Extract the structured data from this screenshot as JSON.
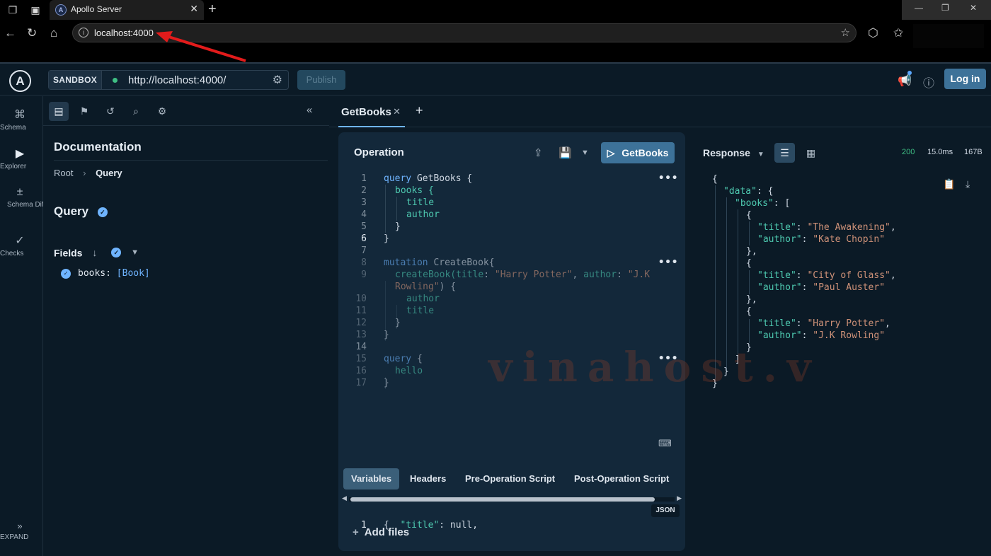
{
  "browser": {
    "tab_title": "Apollo Server",
    "address": "localhost:4000"
  },
  "header": {
    "sandbox_label": "SANDBOX",
    "endpoint": "http://localhost:4000/",
    "publish_label": "Publish",
    "login_label": "Log in"
  },
  "rail": {
    "items": [
      {
        "label": "Schema",
        "icon": "schema-icon"
      },
      {
        "label": "Explorer",
        "icon": "explorer-icon"
      },
      {
        "label": "Schema Diff",
        "icon": "schema-diff-icon"
      },
      {
        "label": "Checks",
        "icon": "checks-icon"
      }
    ],
    "expand_label": "EXPAND"
  },
  "docs": {
    "title": "Documentation",
    "breadcrumb": [
      "Root",
      "Query"
    ],
    "type_title": "Query",
    "fields_label": "Fields",
    "field": {
      "name": "books:",
      "type": "[Book]"
    }
  },
  "tabs": [
    {
      "label": "GetBooks"
    }
  ],
  "operation": {
    "title": "Operation",
    "run_label": "GetBooks",
    "lines": [
      "1",
      "2",
      "3",
      "4",
      "5",
      "6",
      "7",
      "8",
      "9",
      "",
      "10",
      "11",
      "12",
      "13",
      "14",
      "15",
      "16",
      "17"
    ],
    "code": {
      "l1_kw": "query",
      "l1_name": " GetBooks {",
      "l2": "books {",
      "l3": "title",
      "l4": "author",
      "l5": "}",
      "l6": "}",
      "l8_kw": "mutation",
      "l8_name": " CreateBook{",
      "l9_fn": "createBook(",
      "l9_a1": "title",
      "l9_c1": ": ",
      "l9_s1": "\"Harry Potter\"",
      "l9_c2": ", ",
      "l9_a2": "author",
      "l9_c3": ": ",
      "l9_s2": "\"J.K",
      "l9b_s": "Rowling\"",
      "l9b_p": ") {",
      "l10": "author",
      "l11": "title",
      "l12": "}",
      "l13": "}",
      "l15_kw": "query",
      "l15_p": " {",
      "l16": "hello",
      "l17": "}"
    }
  },
  "variables": {
    "tabs": [
      "Variables",
      "Headers",
      "Pre-Operation Script",
      "Post-Operation Script"
    ],
    "json_badge": "JSON",
    "line_no": "1",
    "line_open": "{  ",
    "line_key": "\"title\"",
    "line_rest": ": null,",
    "add_files": "Add files"
  },
  "response": {
    "label": "Response",
    "status": "200",
    "time": "15.0ms",
    "size": "167B",
    "json": {
      "open": "{",
      "data_key": "\"data\"",
      "data_sep": ": {",
      "books_key": "\"books\"",
      "books_sep": ": [",
      "obj_open": "{",
      "title_key": "\"title\"",
      "author_key": "\"author\"",
      "colon": ": ",
      "b1_title": "\"The Awakening\"",
      "b1_author": "\"Kate Chopin\"",
      "b2_title": "\"City of Glass\"",
      "b2_author": "\"Paul Auster\"",
      "b3_title": "\"Harry Potter\"",
      "b3_author": "\"J.K Rowling\"",
      "comma": ",",
      "obj_close_comma": "},",
      "obj_close": "}",
      "arr_close": "]",
      "close": "}"
    }
  },
  "watermark": "vinahost.v"
}
